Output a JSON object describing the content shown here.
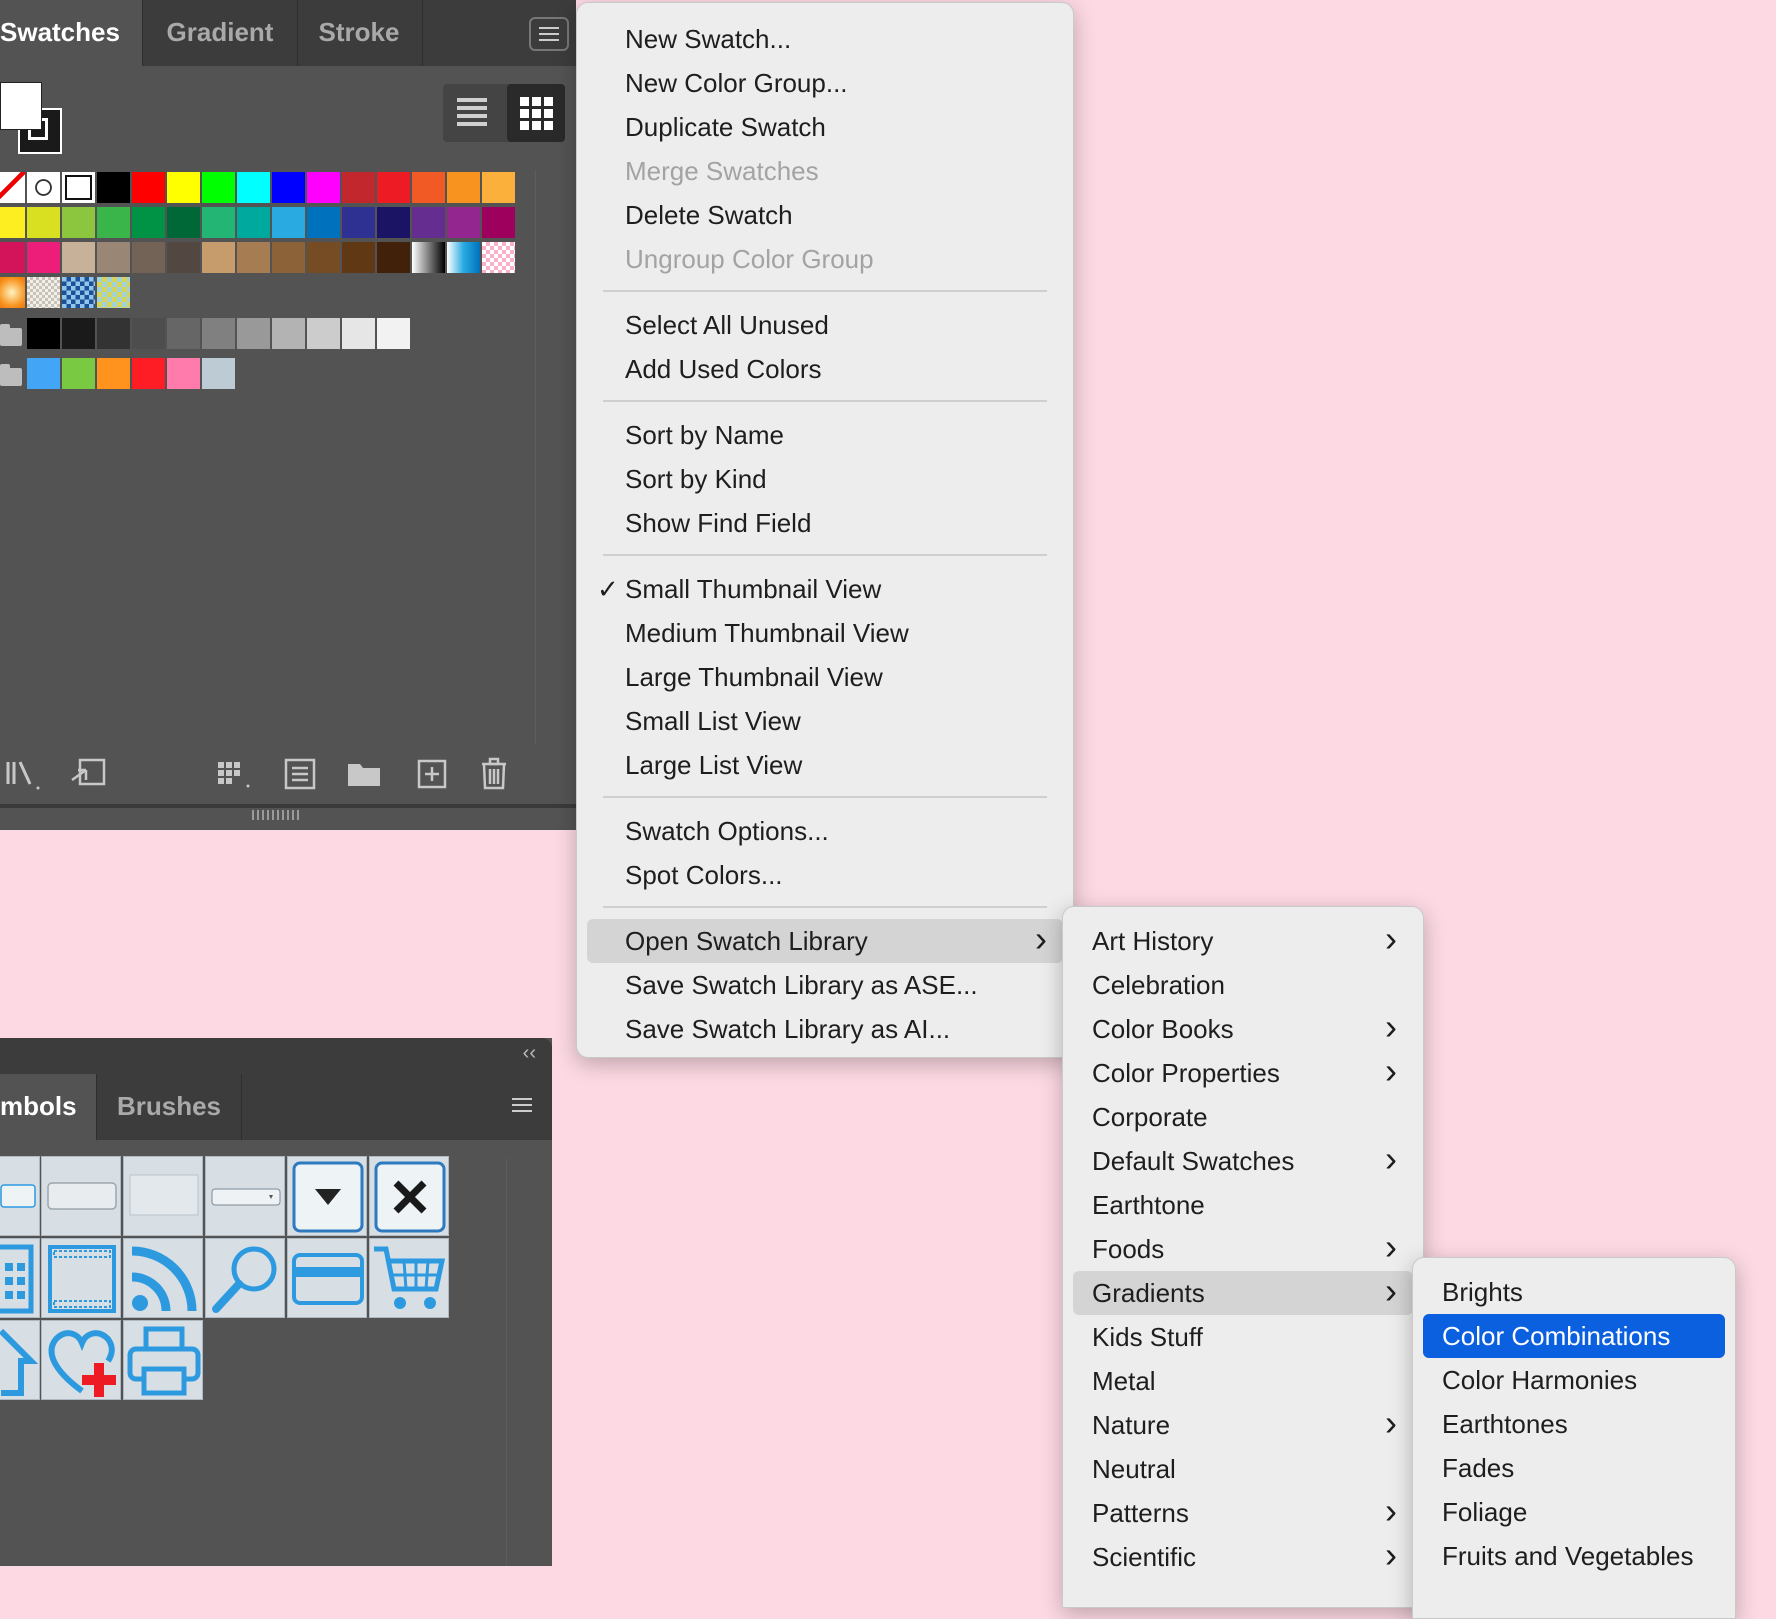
{
  "swatches_panel": {
    "tabs": [
      "Swatches",
      "Gradient",
      "Stroke"
    ],
    "active_tab": "Swatches",
    "view": "Small Thumbnail View",
    "rows": [
      [
        "none",
        "register",
        "#ffffff",
        "#000000",
        "#ff0000",
        "#ffff00",
        "#00ff00",
        "#00ffff",
        "#0000ff",
        "#ff00ff",
        "#c1272d",
        "#ed1c24",
        "#f15a24",
        "#f7931e",
        "#fbb03b"
      ],
      [
        "#fcee21",
        "#d9e021",
        "#8cc63f",
        "#39b54a",
        "#009245",
        "#006837",
        "#22b573",
        "#00a99d",
        "#29abe2",
        "#0071bc",
        "#2e3192",
        "#1b1464",
        "#662d91",
        "#93278f",
        "#9e005d"
      ],
      [
        "#d4145a",
        "#ed1e79",
        "#c7b299",
        "#998675",
        "#736357",
        "#534741",
        "#c69c6d",
        "#a67c52",
        "#8c6239",
        "#754c24",
        "#603813",
        "#42210b",
        "gradient-bw",
        "gradient-blue",
        "pattern-pink"
      ],
      [
        "gradient-orange",
        "pattern-dots",
        "pattern-blue",
        "pattern-yellow"
      ]
    ],
    "grayscale_group": [
      "#000000",
      "#1a1a1a",
      "#333333",
      "#4d4d4d",
      "#666666",
      "#808080",
      "#999999",
      "#b3b3b3",
      "#cccccc",
      "#e6e6e6",
      "#f2f2f2"
    ],
    "color_group": [
      "#42a5f5",
      "#7ac943",
      "#ff931e",
      "#ff1d25",
      "#ff7bac",
      "#bdccd4"
    ]
  },
  "symbols_panel": {
    "tabs": [
      "mbols",
      "Brushes"
    ],
    "active_tab": "mbols"
  },
  "main_menu": [
    {
      "label": "New Swatch...",
      "enabled": true
    },
    {
      "label": "New Color Group...",
      "enabled": true
    },
    {
      "label": "Duplicate Swatch",
      "enabled": true
    },
    {
      "label": "Merge Swatches",
      "enabled": false
    },
    {
      "label": "Delete Swatch",
      "enabled": true
    },
    {
      "label": "Ungroup Color Group",
      "enabled": false
    },
    {
      "label": "Select All Unused",
      "enabled": true
    },
    {
      "label": "Add Used Colors",
      "enabled": true
    },
    {
      "label": "Sort by Name",
      "enabled": true
    },
    {
      "label": "Sort by Kind",
      "enabled": true
    },
    {
      "label": "Show Find Field",
      "enabled": true
    },
    {
      "label": "Small Thumbnail View",
      "enabled": true,
      "checked": true
    },
    {
      "label": "Medium Thumbnail View",
      "enabled": true
    },
    {
      "label": "Large Thumbnail View",
      "enabled": true
    },
    {
      "label": "Small List View",
      "enabled": true
    },
    {
      "label": "Large List View",
      "enabled": true
    },
    {
      "label": "Swatch Options...",
      "enabled": true
    },
    {
      "label": "Spot Colors...",
      "enabled": true
    },
    {
      "label": "Open Swatch Library",
      "enabled": true,
      "submenu": true,
      "highlighted": true
    },
    {
      "label": "Save Swatch Library as ASE...",
      "enabled": true
    },
    {
      "label": "Save Swatch Library as AI...",
      "enabled": true
    }
  ],
  "library_submenu": [
    {
      "label": "Art History",
      "submenu": true
    },
    {
      "label": "Celebration"
    },
    {
      "label": "Color Books",
      "submenu": true
    },
    {
      "label": "Color Properties",
      "submenu": true
    },
    {
      "label": "Corporate"
    },
    {
      "label": "Default Swatches",
      "submenu": true
    },
    {
      "label": "Earthtone"
    },
    {
      "label": "Foods",
      "submenu": true
    },
    {
      "label": "Gradients",
      "submenu": true,
      "highlighted": true
    },
    {
      "label": "Kids Stuff"
    },
    {
      "label": "Metal"
    },
    {
      "label": "Nature",
      "submenu": true
    },
    {
      "label": "Neutral"
    },
    {
      "label": "Patterns",
      "submenu": true
    },
    {
      "label": "Scientific",
      "submenu": true
    }
  ],
  "gradients_submenu": [
    {
      "label": "Brights"
    },
    {
      "label": "Color Combinations",
      "selected": true
    },
    {
      "label": "Color Harmonies"
    },
    {
      "label": "Earthtones"
    },
    {
      "label": "Fades"
    },
    {
      "label": "Foliage"
    },
    {
      "label": "Fruits and Vegetables"
    }
  ],
  "colors": {
    "accent": "#0b60e0",
    "panel": "#535353",
    "panel_dark": "#3c3c3c",
    "background": "#fdd9e3",
    "symbol_blue": "#2d9ae0"
  }
}
